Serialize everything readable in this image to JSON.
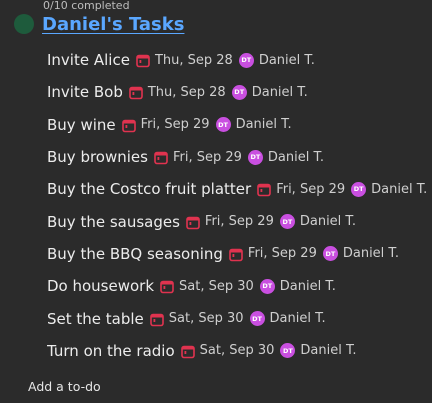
{
  "header": {
    "progress": "0/10 completed",
    "title": "Daniel's Tasks"
  },
  "colors": {
    "background": "#2b2b2b",
    "title_link": "#5aa7ff",
    "calendar_icon": "#e0334f",
    "avatar": "#c94fe0",
    "progress_dot": "#1e5b3c"
  },
  "tasks": [
    {
      "name": "Invite Alice",
      "due": "Thu, Sep 28",
      "avatar": "DT",
      "assignee": "Daniel T."
    },
    {
      "name": "Invite Bob",
      "due": "Thu, Sep 28",
      "avatar": "DT",
      "assignee": "Daniel T."
    },
    {
      "name": "Buy wine",
      "due": "Fri, Sep 29",
      "avatar": "DT",
      "assignee": "Daniel T."
    },
    {
      "name": "Buy brownies",
      "due": "Fri, Sep 29",
      "avatar": "DT",
      "assignee": "Daniel T."
    },
    {
      "name": "Buy the Costco fruit platter",
      "due": "Fri, Sep 29",
      "avatar": "DT",
      "assignee": "Daniel T."
    },
    {
      "name": "Buy the sausages",
      "due": "Fri, Sep 29",
      "avatar": "DT",
      "assignee": "Daniel T."
    },
    {
      "name": "Buy the BBQ seasoning",
      "due": "Fri, Sep 29",
      "avatar": "DT",
      "assignee": "Daniel T."
    },
    {
      "name": "Do housework",
      "due": "Sat, Sep 30",
      "avatar": "DT",
      "assignee": "Daniel T."
    },
    {
      "name": "Set the table",
      "due": "Sat, Sep 30",
      "avatar": "DT",
      "assignee": "Daniel T."
    },
    {
      "name": "Turn on the radio",
      "due": "Sat, Sep 30",
      "avatar": "DT",
      "assignee": "Daniel T."
    }
  ],
  "icons": {
    "due": "calendar-icon"
  },
  "footer": {
    "add_todo_placeholder": "Add a to-do"
  }
}
